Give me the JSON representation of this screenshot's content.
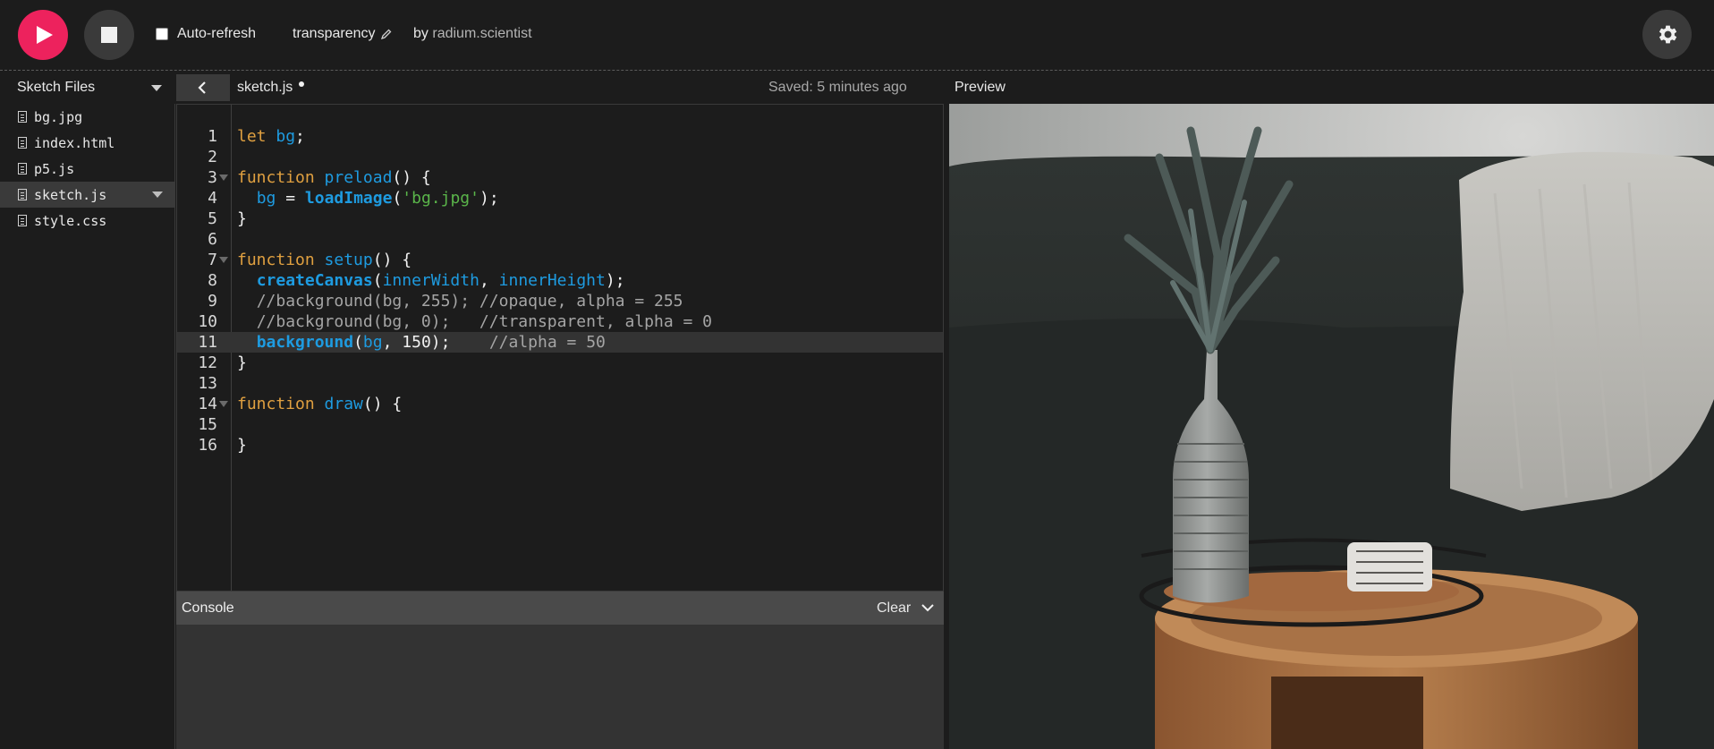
{
  "toolbar": {
    "auto_refresh_label": "Auto-refresh",
    "auto_refresh_checked": false,
    "sketch_name": "transparency",
    "by_label": "by",
    "author": "radium.scientist"
  },
  "files_panel": {
    "title": "Sketch Files",
    "files": [
      {
        "name": "bg.jpg",
        "active": false
      },
      {
        "name": "index.html",
        "active": false
      },
      {
        "name": "p5.js",
        "active": false
      },
      {
        "name": "sketch.js",
        "active": true
      },
      {
        "name": "style.css",
        "active": false
      }
    ]
  },
  "editor": {
    "tab_name": "sketch.js",
    "unsaved": true,
    "saved_status": "Saved: 5 minutes ago",
    "active_line": 11,
    "lines": [
      {
        "n": "1",
        "text": "let bg;"
      },
      {
        "n": "2",
        "text": ""
      },
      {
        "n": "3",
        "text": "function preload() {"
      },
      {
        "n": "4",
        "text": "  bg = loadImage('bg.jpg');"
      },
      {
        "n": "5",
        "text": "}"
      },
      {
        "n": "6",
        "text": ""
      },
      {
        "n": "7",
        "text": "function setup() {"
      },
      {
        "n": "8",
        "text": "  createCanvas(innerWidth, innerHeight);"
      },
      {
        "n": "9",
        "text": "  //background(bg, 255); //opaque, alpha = 255"
      },
      {
        "n": "10",
        "text": "  //background(bg, 0);   //transparent, alpha = 0"
      },
      {
        "n": "11",
        "text": "  background(bg, 150);    //alpha = 50"
      },
      {
        "n": "12",
        "text": "}"
      },
      {
        "n": "13",
        "text": ""
      },
      {
        "n": "14",
        "text": "function draw() {"
      },
      {
        "n": "15",
        "text": ""
      },
      {
        "n": "16",
        "text": "}"
      }
    ]
  },
  "console": {
    "title": "Console",
    "clear_label": "Clear"
  },
  "preview": {
    "title": "Preview"
  },
  "colors": {
    "accent": "#ed225d",
    "background": "#1c1c1c",
    "keyword": "#e0a040",
    "function": "#1e9be0",
    "string": "#5ab54a",
    "comment": "#a5a5a5"
  },
  "icons": [
    "play-icon",
    "stop-icon",
    "pencil-icon",
    "gear-icon",
    "chevron-left-icon",
    "file-icon",
    "chevron-down-icon"
  ]
}
